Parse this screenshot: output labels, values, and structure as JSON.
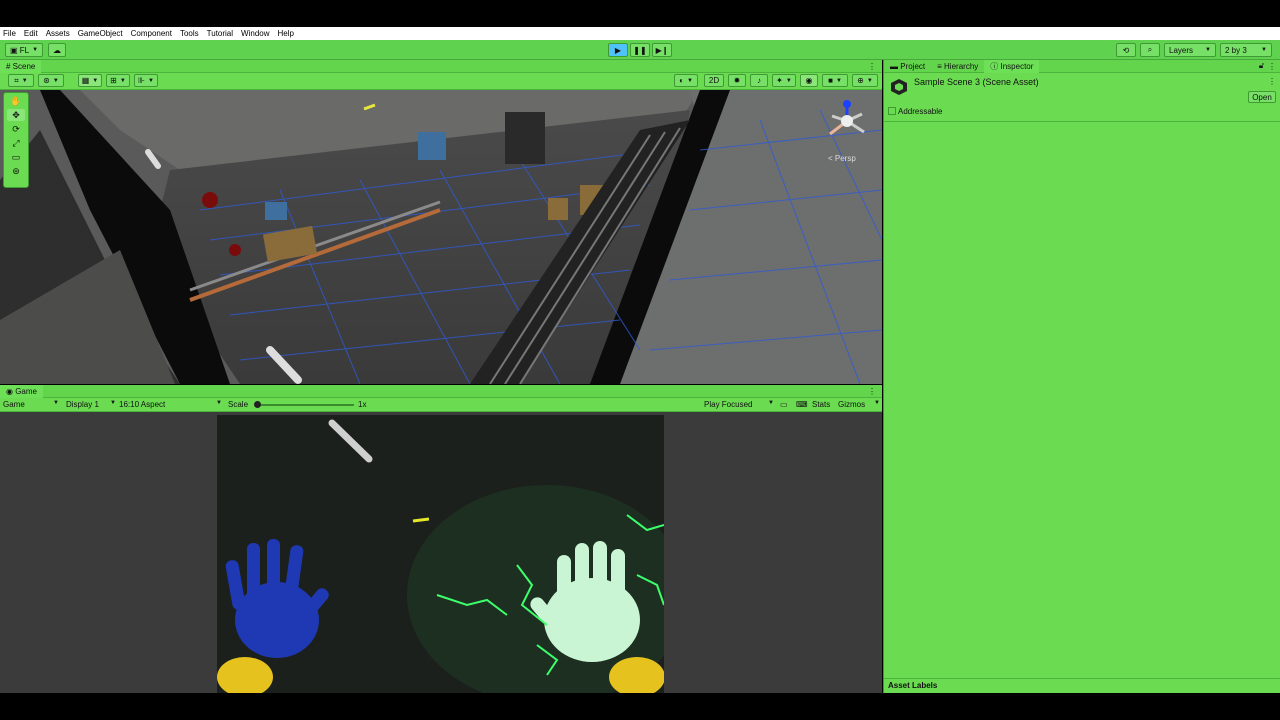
{
  "menu": [
    "File",
    "Edit",
    "Assets",
    "GameObject",
    "Component",
    "Tools",
    "Tutorial",
    "Window",
    "Help"
  ],
  "toolbar": {
    "account_label": "FL",
    "play_icon": "play-icon",
    "pause_icon": "pause-icon",
    "step_icon": "step-icon",
    "layers_label": "Layers",
    "layout_label": "2 by 3"
  },
  "scene": {
    "tab_label": "Scene",
    "btn_2d": "2D",
    "gizmo_label": "< Persp"
  },
  "game": {
    "tab_label": "Game",
    "mode": "Game",
    "display": "Display 1",
    "aspect": "16:10 Aspect",
    "scale_label": "Scale",
    "scale_value": "1x",
    "play_focused": "Play Focused",
    "stats": "Stats",
    "gizmos": "Gizmos"
  },
  "inspector": {
    "tabs": [
      "Project",
      "Hierarchy",
      "Inspector"
    ],
    "title": "Sample Scene 3 (Scene Asset)",
    "open_label": "Open",
    "addressable_label": "Addressable",
    "asset_labels": "Asset Labels"
  },
  "colors": {
    "panel_green": "#6bdb52",
    "toolbar_green": "#5fd24f"
  }
}
